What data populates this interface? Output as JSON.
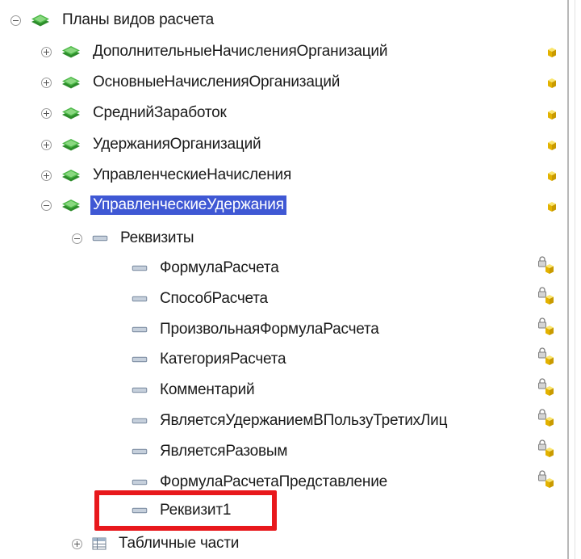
{
  "tree": {
    "root": {
      "label": "Планы видов расчета"
    },
    "children": [
      {
        "label": "ДополнительныеНачисленияОрганизаций"
      },
      {
        "label": "ОсновныеНачисленияОрганизаций"
      },
      {
        "label": "СреднийЗаработок"
      },
      {
        "label": "УдержанияОрганизаций"
      },
      {
        "label": "УправленческиеНачисления"
      },
      {
        "label": "УправленческиеУдержания",
        "selected": true
      }
    ],
    "requisites_group": {
      "label": "Реквизиты"
    },
    "requisites": [
      {
        "label": "ФормулаРасчета"
      },
      {
        "label": "СпособРасчета"
      },
      {
        "label": "ПроизвольнаяФормулаРасчета"
      },
      {
        "label": "КатегорияРасчета"
      },
      {
        "label": "Комментарий"
      },
      {
        "label": "ЯвляетсяУдержаниемВПользуТретихЛиц"
      },
      {
        "label": "ЯвляетсяРазовым"
      },
      {
        "label": "ФормулаРасчетаПредставление"
      },
      {
        "label": "Реквизит1"
      }
    ],
    "tabular_group": {
      "label": "Табличные части"
    }
  },
  "colors": {
    "selection_bg": "#3f58d4",
    "highlight_box": "#e8181c",
    "plan_icon_green": "#3ea33a",
    "cube_yellow": "#f2c80f"
  },
  "icons": {
    "plan": "green-layers-icon",
    "requisite": "dash-attribute-icon",
    "table": "table-grid-icon",
    "support": "yellow-cube-icon",
    "locked": "lock-cube-icon"
  }
}
